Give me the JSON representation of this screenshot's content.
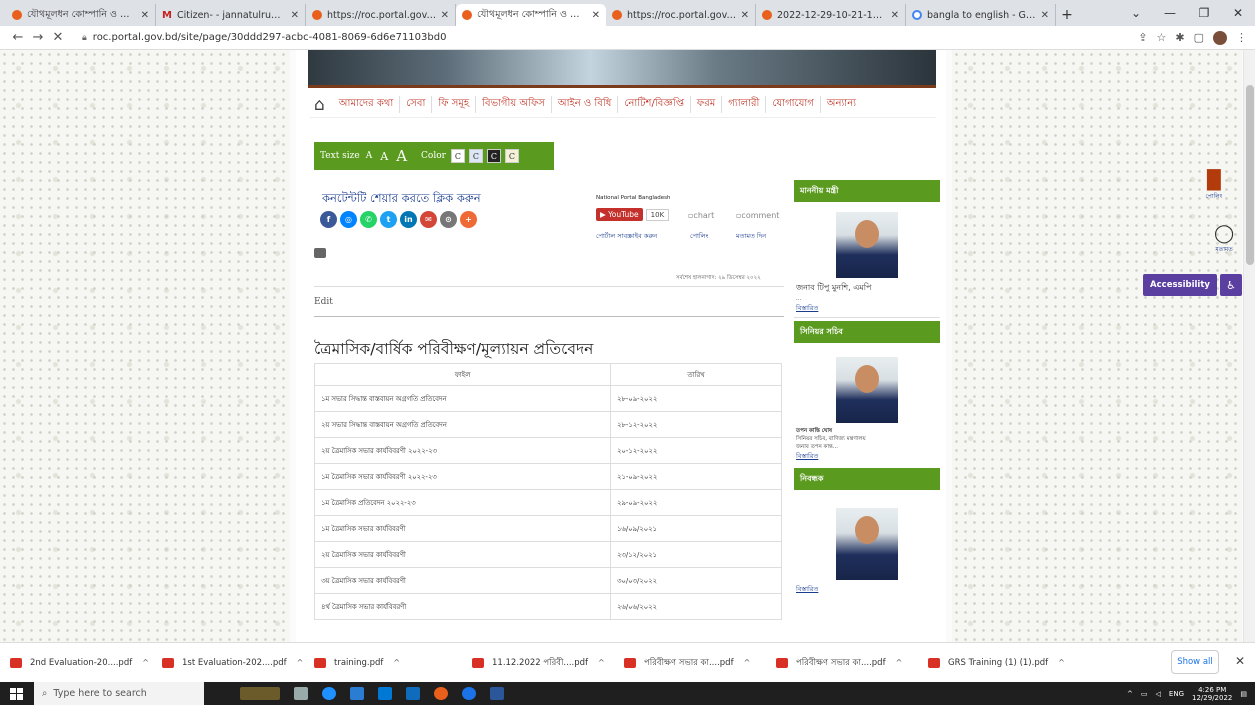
{
  "browser": {
    "tabs": [
      {
        "title": "যৌথমূলধন কোম্পানি ও ফার্মসমূ",
        "icon": "site-icon"
      },
      {
        "title": "Citizen- - jannatulruma18@gma",
        "icon": "gmail-icon"
      },
      {
        "title": "https://roc.portal.gov.bd/npfadi",
        "icon": "site-icon"
      },
      {
        "title": "যৌথমূলধন কোম্পানি ও ফার্মসমূ",
        "icon": "site-icon"
      },
      {
        "title": "https://roc.portal.gov.bd/npfadi",
        "icon": "site-icon"
      },
      {
        "title": "2022-12-29-10-21-1079f70d32",
        "icon": "site-icon"
      },
      {
        "title": "bangla to english - Google Sea",
        "icon": "google-icon"
      }
    ],
    "active_tab": 3,
    "url": "roc.portal.gov.bd/site/page/30ddd297-acbc-4081-8069-6d6e71103bd0"
  },
  "site": {
    "menu": [
      "আমাদের কথা",
      "সেবা",
      "ফি সমূহ",
      "বিভাগীয় অফিস",
      "আইন ও বিধি",
      "নোটিশ/বিজ্ঞপ্তি",
      "ফরম",
      "গ্যালারী",
      "যোগাযোগ",
      "অন্যান্য"
    ],
    "textsize": {
      "label": "Text size",
      "a_small": "A",
      "a_med": "A",
      "a_large": "A",
      "color_label": "Color",
      "swatch": "C"
    },
    "share_title": "কনটেন্টটি শেয়ার করতে ক্লিক করুন",
    "national_portal": "National Portal Bangladesh",
    "youtube": {
      "label": "YouTube",
      "count": "10K"
    },
    "chart_alt": "chart",
    "comment_alt": "comment",
    "portal_subscribe": "পোর্টাল সাবস্ক্রাইব করুন",
    "poll": "পোলিং",
    "opinion": "মতামত দিন",
    "updated": "সর্বশেষ হালনাগাদ: ২৯ ডিসেম্বর ২০২২",
    "edit": "Edit",
    "page_title": "ত্রৈমাসিক/বার্ষিক পরিবীক্ষণ/মূল্যায়ন প্রতিবেদন",
    "table": {
      "headers": [
        "ফাইল",
        "তারিখ"
      ],
      "rows": [
        [
          "১ম সভার সিদ্ধান্ত বাস্তবায়ন অগ্রগতি প্রতিবেদন",
          "২৮-০৯-২০২২"
        ],
        [
          "২য় সভার সিদ্ধান্ত বাস্তবায়ন অগ্রগতি প্রতিবেদন",
          "২৮-১২-২০২২"
        ],
        [
          "২য় ত্রৈমাসিক সভার কার্যবিবরণী ২০২২-২৩",
          "২০-১২-২০২২"
        ],
        [
          "১ম ত্রৈমাসিক সভার কার্যবিবরণী ২০২২-২৩",
          "২১-০৯-২০২২"
        ],
        [
          "১ম ত্রৈমাসিক প্রতিবেদন ২০২২-২৩",
          "২৯-০৯-২০২২"
        ],
        [
          "১ম ত্রৈমাসিক সভার কার্যবিবরণী",
          "১৬/০৯/২০২১"
        ],
        [
          "২য় ত্রৈমাসিক সভার কার্যবিবরণী",
          "২৩/১২/২০২১"
        ],
        [
          "৩য় ত্রৈমাসিক সভার কার্যবিবরণী",
          "৩০/০৩/২০২২"
        ],
        [
          "৪র্থ ত্রৈমাসিক সভার কার্যবিবরণী",
          "২৬/০৬/২০২২"
        ]
      ]
    },
    "sidebar": {
      "minister_heading": "মাননীয় মন্ত্রী",
      "minister_name": "জনাব টিপু মুনশি, এমপি",
      "minister_dots": "...",
      "details": "বিস্তারিত",
      "secretary_heading": "সিনিয়র সচিব",
      "secretary_name": "তপন কান্তি ঘোষ",
      "secretary_role": "সিনিয়র সচিব, বাণিজ্য মন্ত্রণালয়",
      "secretary_desc": "জনাব তপন কান্ত...",
      "registrar_heading": "নিবন্ধক"
    },
    "widgets": {
      "poll": "পোলিং",
      "opinion": "মতামত",
      "accessibility": "Accessibility"
    }
  },
  "downloads": [
    "2nd Evaluation-20....pdf",
    "1st Evaluation-202....pdf",
    "training.pdf",
    "11.12.2022 পরিবী....pdf",
    "পরিবীক্ষণ সভার কা....pdf",
    "পরিবীক্ষণ সভার কা....pdf",
    "GRS Training (1) (1).pdf"
  ],
  "downloads_show_all": "Show all",
  "taskbar": {
    "search_placeholder": "Type here to search",
    "lang": "ENG",
    "time": "4:26 PM",
    "date": "12/29/2022"
  }
}
